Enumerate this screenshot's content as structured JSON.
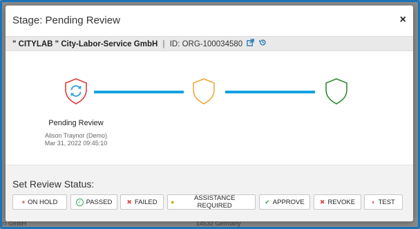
{
  "modal": {
    "title": "Stage: Pending Review",
    "close_symbol": "×"
  },
  "org": {
    "name": "\" CITYLAB \" City-Labor-Service GmbH",
    "separator": "|",
    "id_text": "ID: ORG-100034580",
    "icons": [
      "external-link-icon",
      "history-icon"
    ]
  },
  "stages": [
    {
      "state": "current",
      "color": "#e03a3a",
      "icon": "refresh-icon",
      "label": "Pending Review",
      "user": "Alison Traynor (Demo)",
      "timestamp": "Mar 31, 2022 09:45:10"
    },
    {
      "state": "pending",
      "color": "#f0a53a",
      "icon": "shield-icon",
      "label": "",
      "user": "",
      "timestamp": ""
    },
    {
      "state": "pending",
      "color": "#2e8b2e",
      "icon": "shield-icon",
      "label": "",
      "user": "",
      "timestamp": ""
    }
  ],
  "review": {
    "label": "Set Review Status:",
    "buttons": [
      {
        "label": "ON HOLD",
        "icon": "pause-icon",
        "icon_char": "⏸",
        "icon_color": "#d9534f"
      },
      {
        "label": "PASSED",
        "icon": "check-circle-icon",
        "icon_char": "✓",
        "icon_color": "#3aa55a"
      },
      {
        "label": "FAILED",
        "icon": "x-icon",
        "icon_char": "✖",
        "icon_color": "#d9534f"
      },
      {
        "label": "ASSISTANCE REQUIRED",
        "icon": "user-icon",
        "icon_char": "●",
        "icon_color": "#e0a020"
      },
      {
        "label": "APPROVE",
        "icon": "check-icon",
        "icon_char": "✔",
        "icon_color": "#3aa55a"
      },
      {
        "label": "REVOKE",
        "icon": "x-icon",
        "icon_char": "✖",
        "icon_color": "#d9534f"
      },
      {
        "label": "TEST",
        "icon": "half-circle-icon",
        "icon_char": "◐",
        "icon_color": "#d9534f"
      }
    ]
  },
  "background": {
    "left_fragment": "m GmbH",
    "right_fragment": "14532 Germany"
  }
}
